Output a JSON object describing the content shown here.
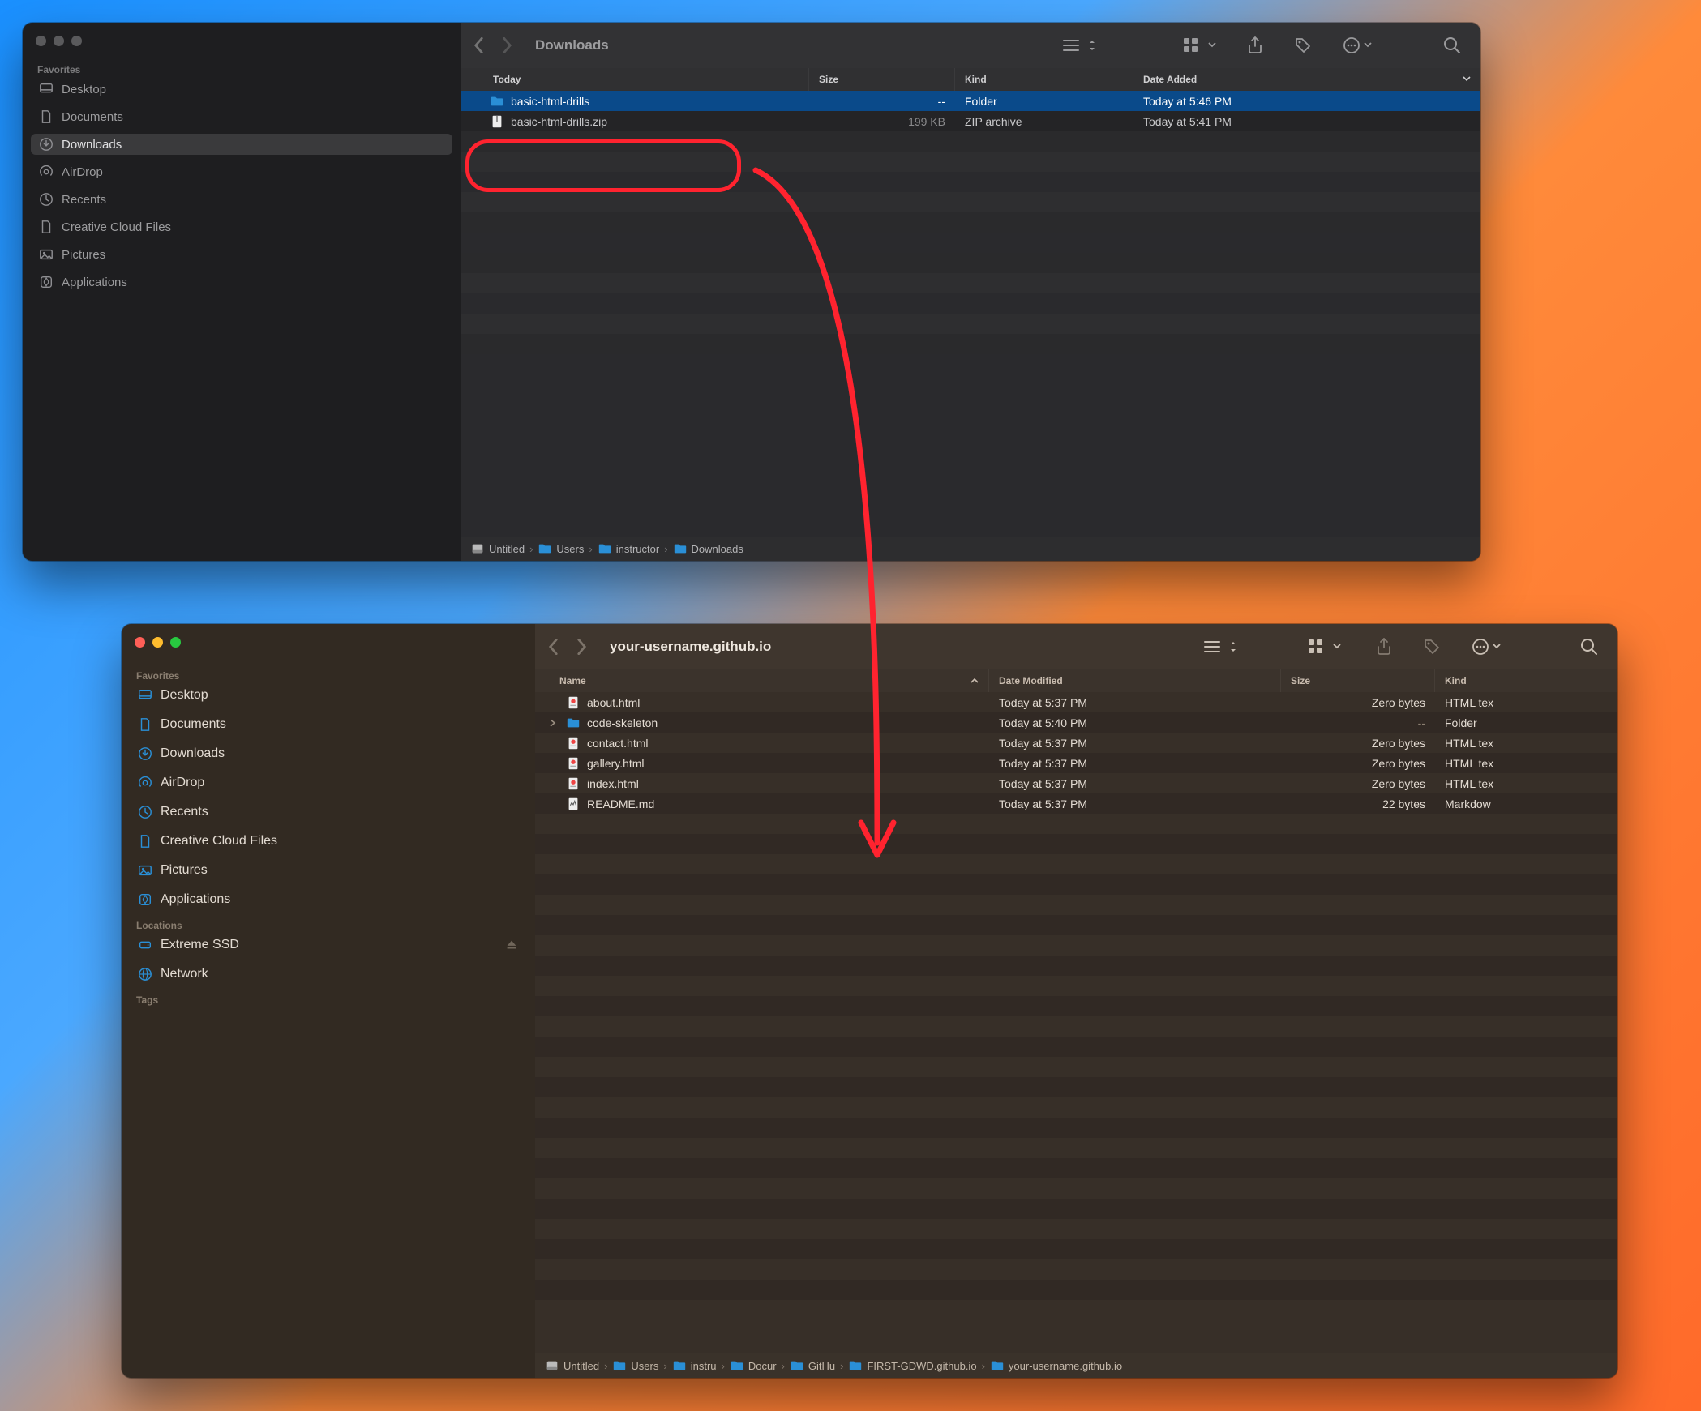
{
  "window1": {
    "title": "Downloads",
    "sidebar": {
      "section": "Favorites",
      "items": [
        {
          "icon": "desktop",
          "label": "Desktop"
        },
        {
          "icon": "document",
          "label": "Documents"
        },
        {
          "icon": "download",
          "label": "Downloads",
          "selected": true
        },
        {
          "icon": "airdrop",
          "label": "AirDrop"
        },
        {
          "icon": "clock",
          "label": "Recents"
        },
        {
          "icon": "document",
          "label": "Creative Cloud Files"
        },
        {
          "icon": "image",
          "label": "Pictures"
        },
        {
          "icon": "app",
          "label": "Applications"
        }
      ]
    },
    "columns": {
      "name": "Today",
      "size": "Size",
      "kind": "Kind",
      "date": "Date Added"
    },
    "rows": [
      {
        "icon": "folder",
        "name": "basic-html-drills",
        "size": "--",
        "kind": "Folder",
        "date": "Today at 5:46 PM",
        "selected": true
      },
      {
        "icon": "zip",
        "name": "basic-html-drills.zip",
        "size": "199 KB",
        "kind": "ZIP archive",
        "date": "Today at 5:41 PM"
      }
    ],
    "path": [
      {
        "icon": "disk",
        "label": "Untitled"
      },
      {
        "icon": "folder",
        "label": "Users"
      },
      {
        "icon": "folder",
        "label": "instructor"
      },
      {
        "icon": "folder",
        "label": "Downloads"
      }
    ]
  },
  "window2": {
    "title": "your-username.github.io",
    "sidebar": {
      "sections": [
        {
          "label": "Favorites",
          "items": [
            {
              "icon": "desktop",
              "label": "Desktop"
            },
            {
              "icon": "document",
              "label": "Documents"
            },
            {
              "icon": "download",
              "label": "Downloads"
            },
            {
              "icon": "airdrop",
              "label": "AirDrop"
            },
            {
              "icon": "clock",
              "label": "Recents"
            },
            {
              "icon": "document",
              "label": "Creative Cloud Files"
            },
            {
              "icon": "image",
              "label": "Pictures"
            },
            {
              "icon": "app",
              "label": "Applications"
            }
          ]
        },
        {
          "label": "Locations",
          "items": [
            {
              "icon": "drive",
              "label": "Extreme SSD",
              "eject": true
            },
            {
              "icon": "globe",
              "label": "Network"
            }
          ]
        },
        {
          "label": "Tags",
          "items": []
        }
      ]
    },
    "columns": {
      "name": "Name",
      "date": "Date Modified",
      "size": "Size",
      "kind": "Kind"
    },
    "rows": [
      {
        "icon": "html",
        "name": "about.html",
        "date": "Today at 5:37 PM",
        "size": "Zero bytes",
        "kind": "HTML tex"
      },
      {
        "icon": "folder",
        "name": "code-skeleton",
        "date": "Today at 5:40 PM",
        "size": "--",
        "kind": "Folder",
        "expandable": true
      },
      {
        "icon": "html",
        "name": "contact.html",
        "date": "Today at 5:37 PM",
        "size": "Zero bytes",
        "kind": "HTML tex"
      },
      {
        "icon": "html",
        "name": "gallery.html",
        "date": "Today at 5:37 PM",
        "size": "Zero bytes",
        "kind": "HTML tex"
      },
      {
        "icon": "html",
        "name": "index.html",
        "date": "Today at 5:37 PM",
        "size": "Zero bytes",
        "kind": "HTML tex"
      },
      {
        "icon": "md",
        "name": "README.md",
        "date": "Today at 5:37 PM",
        "size": "22 bytes",
        "kind": "Markdow"
      }
    ],
    "path": [
      {
        "icon": "disk",
        "label": "Untitled"
      },
      {
        "icon": "folder",
        "label": "Users"
      },
      {
        "icon": "folder",
        "label": "instru"
      },
      {
        "icon": "folder",
        "label": "Docur"
      },
      {
        "icon": "folder",
        "label": "GitHu"
      },
      {
        "icon": "folder",
        "label": "FIRST-GDWD.github.io"
      },
      {
        "icon": "folder",
        "label": "your-username.github.io"
      }
    ]
  }
}
